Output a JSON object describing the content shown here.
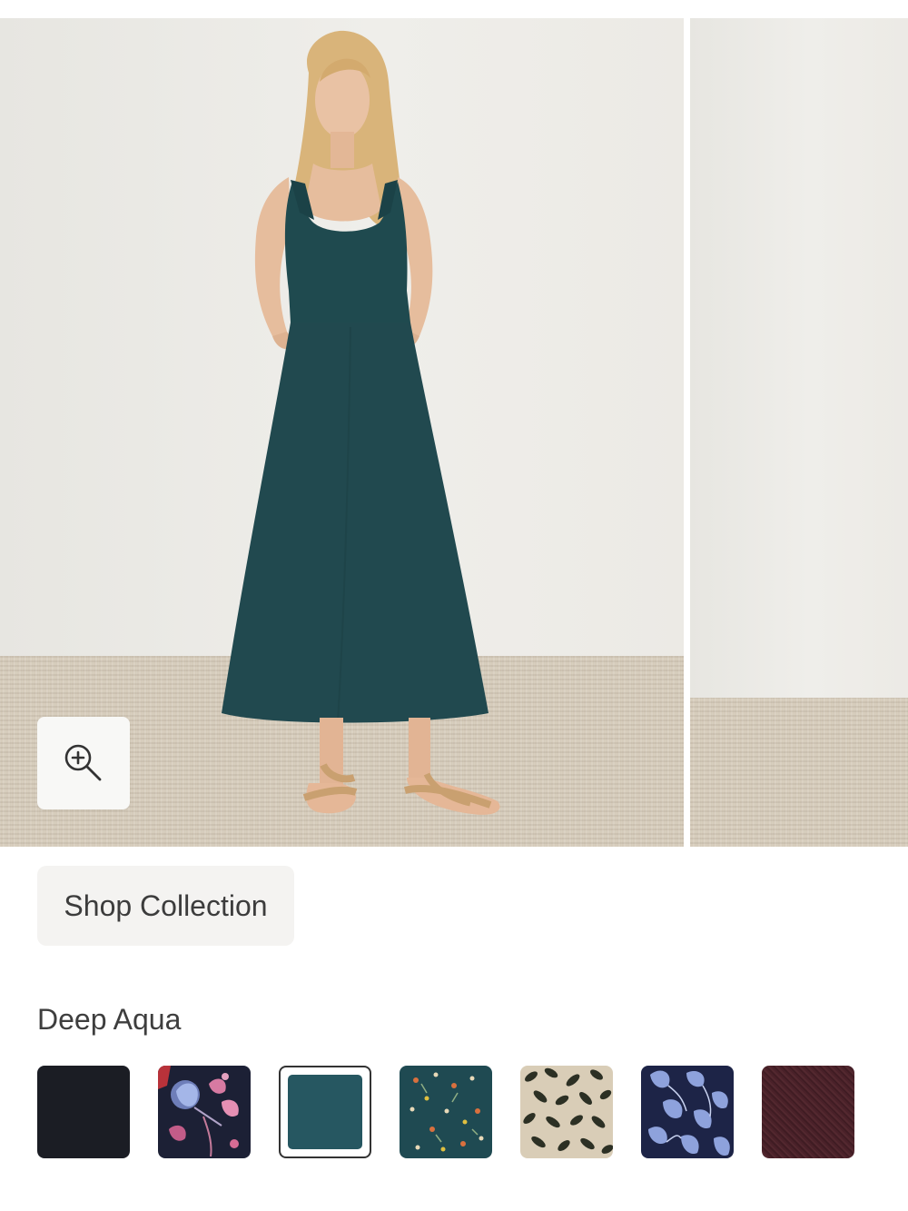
{
  "gallery": {
    "zoom_icon": "zoom-in-icon"
  },
  "shop": {
    "label": "Shop Collection"
  },
  "color": {
    "selected_name": "Deep Aqua"
  },
  "swatches": [
    {
      "name": "black",
      "color": "#1b1d24",
      "selected": false
    },
    {
      "name": "navy-floral",
      "color": "#1c2035",
      "selected": false
    },
    {
      "name": "deep-aqua",
      "color": "#265761",
      "selected": true
    },
    {
      "name": "aqua-ditsy-floral",
      "color": "#1f4a52",
      "selected": false
    },
    {
      "name": "leaf-print",
      "color": "#d9cdb7",
      "selected": false
    },
    {
      "name": "navy-blue-floral",
      "color": "#1d2447",
      "selected": false
    },
    {
      "name": "heather-plum",
      "color": "#4a2129",
      "selected": false
    }
  ]
}
